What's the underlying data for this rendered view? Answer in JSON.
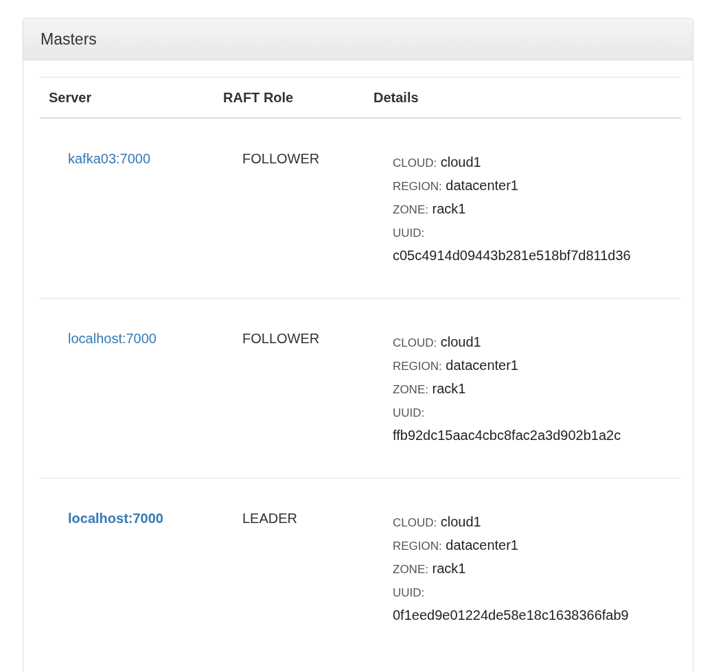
{
  "panel": {
    "title": "Masters"
  },
  "table": {
    "columns": [
      "Server",
      "RAFT Role",
      "Details"
    ],
    "rows": [
      {
        "server": "kafka03:7000",
        "current": false,
        "role": "FOLLOWER",
        "details": [
          {
            "label": "CLOUD:",
            "value": "cloud1"
          },
          {
            "label": "REGION:",
            "value": "datacenter1"
          },
          {
            "label": "ZONE:",
            "value": "rack1"
          },
          {
            "label": "UUID:",
            "value": "c05c4914d09443b281e518bf7d811d36"
          }
        ]
      },
      {
        "server": "localhost:7000",
        "current": false,
        "role": "FOLLOWER",
        "details": [
          {
            "label": "CLOUD:",
            "value": "cloud1"
          },
          {
            "label": "REGION:",
            "value": "datacenter1"
          },
          {
            "label": "ZONE:",
            "value": "rack1"
          },
          {
            "label": "UUID:",
            "value": "ffb92dc15aac4cbc8fac2a3d902b1a2c"
          }
        ]
      },
      {
        "server": "localhost:7000",
        "current": true,
        "role": "LEADER",
        "details": [
          {
            "label": "CLOUD:",
            "value": "cloud1"
          },
          {
            "label": "REGION:",
            "value": "datacenter1"
          },
          {
            "label": "ZONE:",
            "value": "rack1"
          },
          {
            "label": "UUID:",
            "value": "0f1eed9e01224de58e18c1638366fab9"
          }
        ]
      }
    ]
  }
}
